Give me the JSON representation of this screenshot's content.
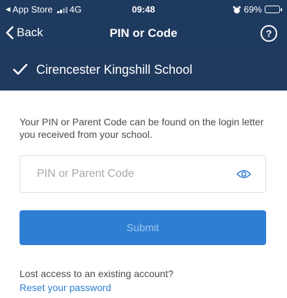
{
  "status_bar": {
    "source_app": "App Store",
    "network": "4G",
    "time": "09:48",
    "battery": "69%",
    "battery_level": 0.69
  },
  "nav": {
    "back_label": "Back",
    "title": "PIN or Code",
    "help_label": "?"
  },
  "school": {
    "name": "Cirencester Kingshill School"
  },
  "form": {
    "helper_text": "Your PIN or Parent Code can be found on the login letter you received from your school.",
    "pin_value": "",
    "pin_placeholder": "PIN or Parent Code",
    "submit_label": "Submit"
  },
  "footer": {
    "lost_access_text": "Lost access to an existing account?",
    "reset_link_label": "Reset your password"
  },
  "colors": {
    "header": "#1f3a5f",
    "accent": "#2e7fd3"
  },
  "icons": {
    "back": "chevron-left-icon",
    "help": "question-circle-icon",
    "check": "checkmark-icon",
    "toggle_visibility": "eye-icon",
    "alarm": "alarm-clock-icon",
    "battery": "battery-icon"
  }
}
